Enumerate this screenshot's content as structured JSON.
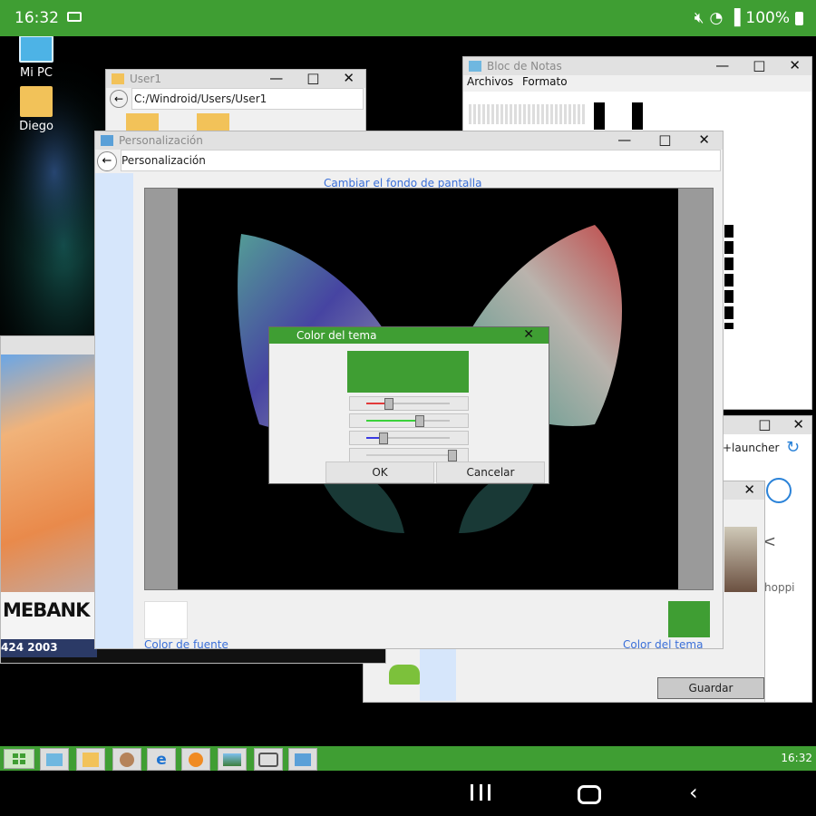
{
  "status_bar": {
    "time": "16:32",
    "battery": "100%",
    "icons": [
      "cast-icon",
      "mute-icon",
      "wifi-icon",
      "signal-icon",
      "battery-icon"
    ]
  },
  "desktop": {
    "icons": [
      {
        "label": "Mi PC",
        "icon": "computer-icon"
      },
      {
        "label": "Diego",
        "icon": "folder-icon"
      }
    ]
  },
  "explorer_window": {
    "title": "User1",
    "address": "C:/Windroid/Users/User1"
  },
  "notepad_window": {
    "title": "Bloc de Notas",
    "menu": [
      "Archivos",
      "Formato"
    ]
  },
  "browser_window": {
    "address_fragment": "+launcher",
    "tile_text": "hoppi"
  },
  "bank_window": {
    "banner_text": "MEBANK",
    "banner_subtext": "424 2003"
  },
  "launcher_window": {
    "save_label": "Guardar"
  },
  "personalization_window": {
    "title": "Personalización",
    "address": "Personalización",
    "change_wallpaper_label": "Cambiar el fondo de pantalla",
    "font_color_label": "Color de fuente",
    "theme_color_label": "Color del tema",
    "font_color": "#ffffff",
    "theme_color": "#3f9e33"
  },
  "color_dialog": {
    "title": "Color del tema",
    "preview_color": "#3f9e33",
    "sliders": [
      {
        "name": "red",
        "color": "#e23a3a",
        "fraction": 0.25
      },
      {
        "name": "green",
        "color": "#3bd13b",
        "fraction": 0.62
      },
      {
        "name": "blue",
        "color": "#3a3ae2",
        "fraction": 0.19
      },
      {
        "name": "alpha",
        "color": "#cccccc",
        "fraction": 1.0
      }
    ],
    "ok_label": "OK",
    "cancel_label": "Cancelar"
  },
  "taskbar": {
    "clock": "16:32",
    "start_icon": "windows-start-icon",
    "apps": [
      "desktop-app-icon",
      "folder-app-icon",
      "users-app-icon",
      "edge-icon",
      "media-player-icon",
      "photos-icon",
      "camera-icon",
      "personalization-app-icon"
    ]
  },
  "navigation": {
    "recents": "recent-apps-icon",
    "home": "home-icon",
    "back": "back-icon"
  },
  "colors": {
    "accent": "#3f9e33",
    "link": "#3a6fd8"
  }
}
